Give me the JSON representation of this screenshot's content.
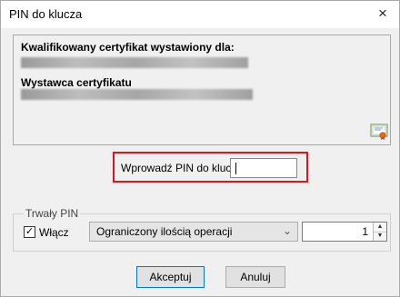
{
  "window": {
    "title": "PIN do klucza",
    "close_glyph": "×"
  },
  "certificate": {
    "issued_for_label": "Kwalifikowany certyfikat wystawiony dla:",
    "issuer_label": "Wystawca certyfikatu",
    "icon": "certificate-icon"
  },
  "pin": {
    "label": "Wprowadź PIN do klucza",
    "value": ""
  },
  "persistent_pin": {
    "group_label": "Trwały PIN",
    "enable_label": "Włącz",
    "enable_checked": true,
    "mode_selected": "Ograniczony ilością operacji",
    "count_value": "1"
  },
  "buttons": {
    "accept": "Akceptuj",
    "cancel": "Anuluj"
  },
  "colors": {
    "highlight": "#e0141c",
    "default_button_border": "#0078d7"
  }
}
